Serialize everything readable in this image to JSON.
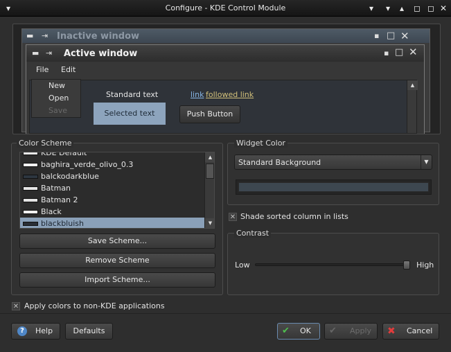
{
  "window": {
    "title": "Configure - KDE Control Module"
  },
  "preview": {
    "inactive_title": "Inactive window",
    "active_title": "Active window",
    "menu": [
      "File",
      "Edit"
    ],
    "dropdown_items": [
      "New",
      "Open",
      "Save"
    ],
    "standard_text": "Standard text",
    "selected_text": "Selected text",
    "link": "link",
    "followed_link": "followed link",
    "push_button": "Push Button"
  },
  "color_scheme": {
    "title": "Color Scheme",
    "items": [
      {
        "label": "KDE Default",
        "swatch": "#e8e8e8"
      },
      {
        "label": "baghira_verde_olivo_0.3",
        "swatch": "#f2f2f2"
      },
      {
        "label": "balckodarkblue",
        "swatch": "#2d3640"
      },
      {
        "label": "Batman",
        "swatch": "#e6e6e6"
      },
      {
        "label": "Batman 2",
        "swatch": "#e6e6e6"
      },
      {
        "label": "Black",
        "swatch": "#f0f0f0"
      },
      {
        "label": "blackbluish",
        "swatch": "#2a2f36"
      }
    ],
    "selected_index": 6,
    "save_label": "Save Scheme...",
    "remove_label": "Remove Scheme",
    "import_label": "Import Scheme..."
  },
  "widget_color": {
    "title": "Widget Color",
    "selected": "Standard Background",
    "swatch": "#3d4750"
  },
  "shade_sorted": {
    "label": "Shade sorted column in lists",
    "checked": true
  },
  "contrast": {
    "title": "Contrast",
    "low": "Low",
    "high": "High",
    "value": 1.0
  },
  "apply_colors": {
    "label": "Apply colors to non-KDE applications",
    "checked": true
  },
  "buttons": {
    "help": "Help",
    "defaults": "Defaults",
    "ok": "OK",
    "apply": "Apply",
    "cancel": "Cancel"
  },
  "colors": {
    "selection": "#8da4bd",
    "link": "#87b5e5",
    "followed_link": "#d2c07a",
    "list_selected": "#8aa0b8"
  }
}
